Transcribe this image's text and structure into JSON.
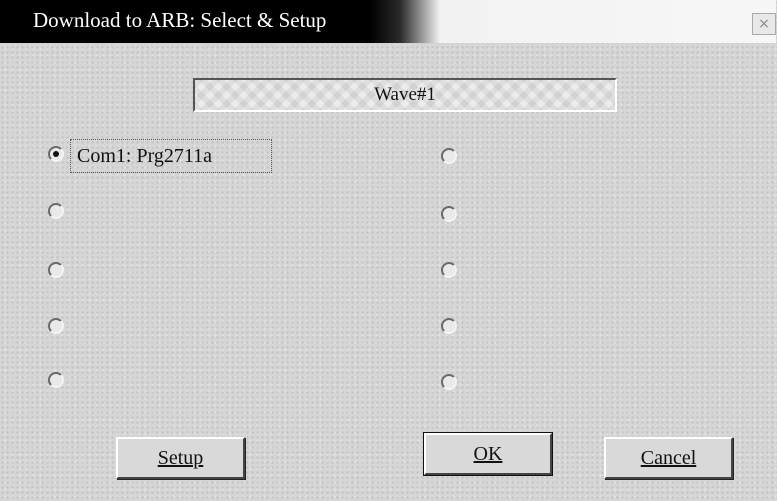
{
  "window": {
    "title": "Download to ARB: Select & Setup",
    "close_glyph": "×"
  },
  "wave_field": {
    "value": "Wave#1"
  },
  "ports": {
    "left": [
      {
        "label": "Com1: Prg2711a",
        "checked": true
      },
      {
        "label": "",
        "checked": false
      },
      {
        "label": "",
        "checked": false
      },
      {
        "label": "",
        "checked": false
      },
      {
        "label": "",
        "checked": false
      }
    ],
    "right": [
      {
        "label": "",
        "checked": false
      },
      {
        "label": "",
        "checked": false
      },
      {
        "label": "",
        "checked": false
      },
      {
        "label": "",
        "checked": false
      },
      {
        "label": "",
        "checked": false
      }
    ]
  },
  "buttons": {
    "setup_label": "Setup",
    "ok_label": "OK",
    "cancel_label": "Cancel"
  }
}
